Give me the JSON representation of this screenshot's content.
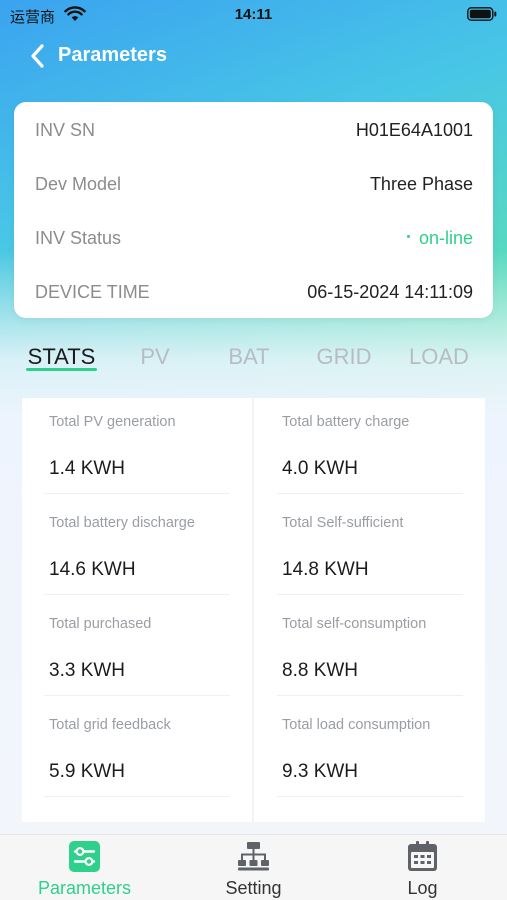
{
  "status_bar": {
    "carrier": "运营商",
    "time": "14:11"
  },
  "header": {
    "title": "Parameters"
  },
  "device_info": [
    {
      "label": "INV SN",
      "value": "H01E64A1001"
    },
    {
      "label": "Dev Model",
      "value": "Three Phase"
    },
    {
      "label": "INV Status",
      "value": "on-line"
    },
    {
      "label": "DEVICE TIME",
      "value": "06-15-2024 14:11:09"
    }
  ],
  "tabs": [
    {
      "label": "STATS",
      "active": true
    },
    {
      "label": "PV",
      "active": false
    },
    {
      "label": "BAT",
      "active": false
    },
    {
      "label": "GRID",
      "active": false
    },
    {
      "label": "LOAD",
      "active": false
    }
  ],
  "stats": [
    {
      "label": "Total PV generation",
      "value": "1.4 KWH"
    },
    {
      "label": "Total battery charge",
      "value": "4.0 KWH"
    },
    {
      "label": "Total battery discharge",
      "value": "14.6 KWH"
    },
    {
      "label": "Total Self-sufficient",
      "value": "14.8 KWH"
    },
    {
      "label": "Total purchased",
      "value": "3.3 KWH"
    },
    {
      "label": "Total self-consumption",
      "value": "8.8 KWH"
    },
    {
      "label": "Total grid feedback",
      "value": "5.9 KWH"
    },
    {
      "label": "Total load consumption",
      "value": "9.3 KWH"
    }
  ],
  "bottom_tabs": [
    {
      "label": "Parameters",
      "icon": "sliders-icon",
      "active": true
    },
    {
      "label": "Setting",
      "icon": "network-icon",
      "active": false
    },
    {
      "label": "Log",
      "icon": "calendar-icon",
      "active": false
    }
  ],
  "colors": {
    "accent": "#2ed08c",
    "inactive_tab": "#b7bcc4"
  }
}
